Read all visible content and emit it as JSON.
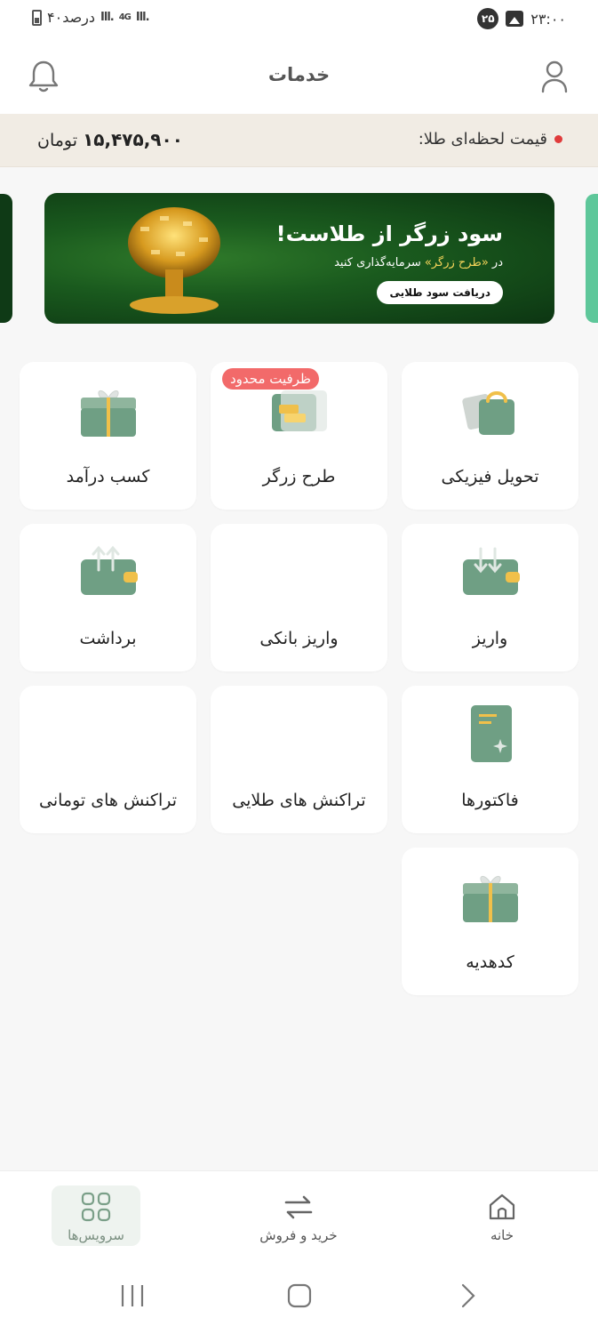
{
  "status_bar": {
    "battery": "۴۰درصد",
    "network": "4G",
    "time": "۲۳:۰۰",
    "notification_count": "۲۵"
  },
  "header": {
    "title": "خدمات"
  },
  "gold_price": {
    "label": "قیمت لحظه‌ای طلا:",
    "value": "۱۵,۴۷۵,۹۰۰",
    "unit": "تومان"
  },
  "banner": {
    "headline": "سود زرگر از طلاست!",
    "sub_prefix": "در",
    "sub_highlight": "«طرح زرگر»",
    "sub_suffix": "سرمایه‌گذاری کنید",
    "cta": "دریافت سود طلایی"
  },
  "services": [
    {
      "label": "تحویل فیزیکی",
      "icon": "shopping-bag-icon"
    },
    {
      "label": "طرح زرگر",
      "icon": "gold-bars-icon",
      "badge": "ظرفیت محدود"
    },
    {
      "label": "کسب درآمد",
      "icon": "gift-icon"
    },
    {
      "label": "واریز",
      "icon": "wallet-deposit-icon"
    },
    {
      "label": "واریز بانکی",
      "icon": ""
    },
    {
      "label": "برداشت",
      "icon": "wallet-withdraw-icon"
    },
    {
      "label": "فاکتورها",
      "icon": "invoice-icon"
    },
    {
      "label": "تراکنش های طلایی",
      "icon": ""
    },
    {
      "label": "تراکنش های تومانی",
      "icon": ""
    },
    {
      "label": "کدهدیه",
      "icon": "gift-code-icon"
    }
  ],
  "bottom_nav": {
    "home": "خانه",
    "trade": "خرید و فروش",
    "services": "سرویس‌ها"
  },
  "colors": {
    "accent_green": "#6f9f84",
    "gold": "#f0c04a",
    "badge_red": "#f26a6a",
    "price_bg": "#f1ece4"
  }
}
